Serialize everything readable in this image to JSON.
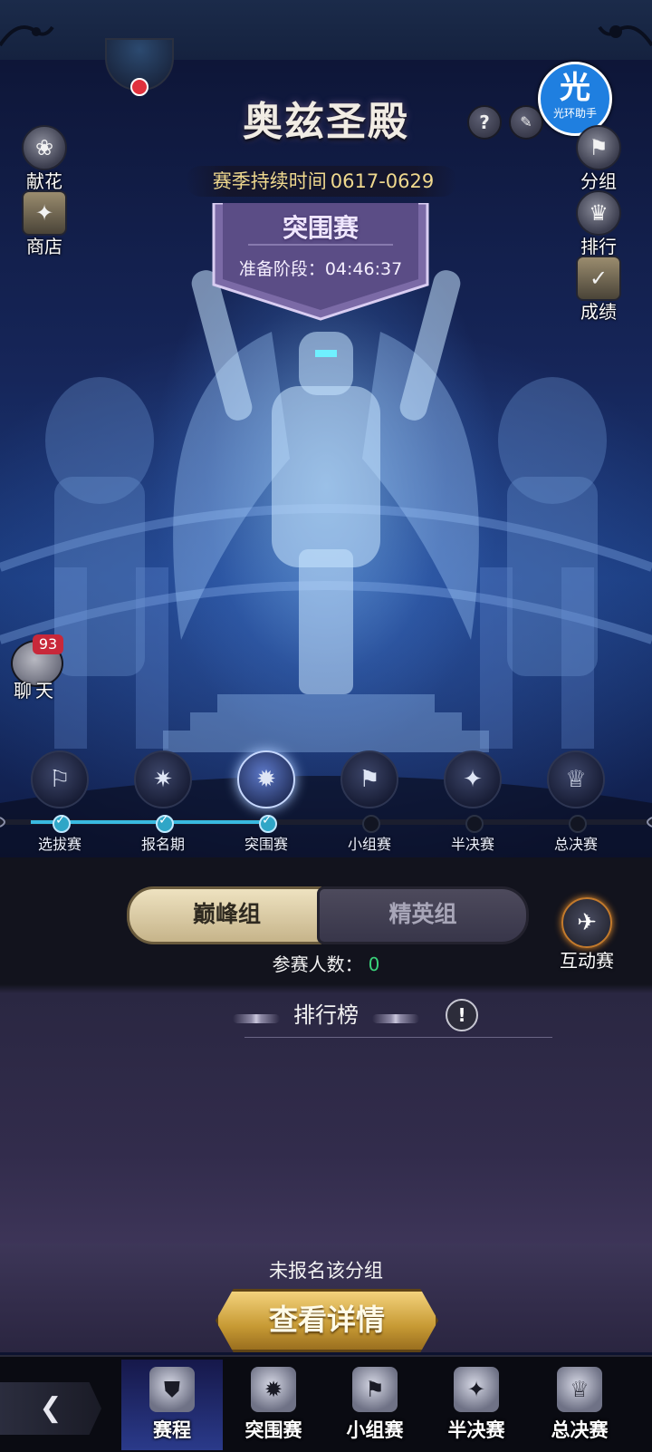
{
  "header": {
    "title": "奥兹圣殿",
    "season_label": "赛季持续时间",
    "season_range": "0617-0629",
    "help_icon": "?",
    "scroll_icon": "scroll-icon"
  },
  "banner": {
    "title": "突围赛",
    "phase_label": "准备阶段：04:46:37"
  },
  "helper": {
    "glyph": "光",
    "label": "光环助手"
  },
  "left_menu": [
    {
      "label": "献花",
      "icon": "flower-icon"
    },
    {
      "label": "商店",
      "icon": "shop-icon"
    }
  ],
  "right_menu": [
    {
      "label": "分组",
      "icon": "group-icon"
    },
    {
      "label": "排行",
      "icon": "ranking-icon"
    },
    {
      "label": "成绩",
      "icon": "results-icon"
    }
  ],
  "chat": {
    "label": "聊天",
    "badge": "93"
  },
  "stages": [
    {
      "label": "选拔赛",
      "icon": "flag-icon",
      "done": true
    },
    {
      "label": "报名期",
      "icon": "book-icon",
      "done": true
    },
    {
      "label": "突围赛",
      "icon": "banner-icon",
      "done": true,
      "active": true
    },
    {
      "label": "小组赛",
      "icon": "group-flag-icon",
      "done": false
    },
    {
      "label": "半决赛",
      "icon": "shield-icon",
      "done": false
    },
    {
      "label": "总决赛",
      "icon": "trophy-icon",
      "done": false
    }
  ],
  "tabs": {
    "peak": "巅峰组",
    "elite": "精英组",
    "selected": "巅峰组"
  },
  "participants": {
    "label": "参赛人数：",
    "count": "0"
  },
  "interact": {
    "label": "互动赛",
    "icon": "paper-plane-icon"
  },
  "ranking": {
    "title": "排行榜",
    "info_icon": "!"
  },
  "status": {
    "text": "未报名该分组",
    "button": "查看详情"
  },
  "nav": {
    "back_icon": "back-arrow-icon",
    "items": [
      {
        "label": "赛程",
        "icon": "schedule-icon",
        "active": true
      },
      {
        "label": "突围赛",
        "icon": "breakout-icon",
        "active": false
      },
      {
        "label": "小组赛",
        "icon": "group-stage-icon",
        "active": false
      },
      {
        "label": "半决赛",
        "icon": "semifinal-icon",
        "active": false
      },
      {
        "label": "总决赛",
        "icon": "final-icon",
        "active": false
      }
    ]
  },
  "colors": {
    "accent_gold": "#f0d98e",
    "participant_count": "#39d27a",
    "chat_badge": "#c8283a",
    "progress_done": "#2fa6c7"
  }
}
